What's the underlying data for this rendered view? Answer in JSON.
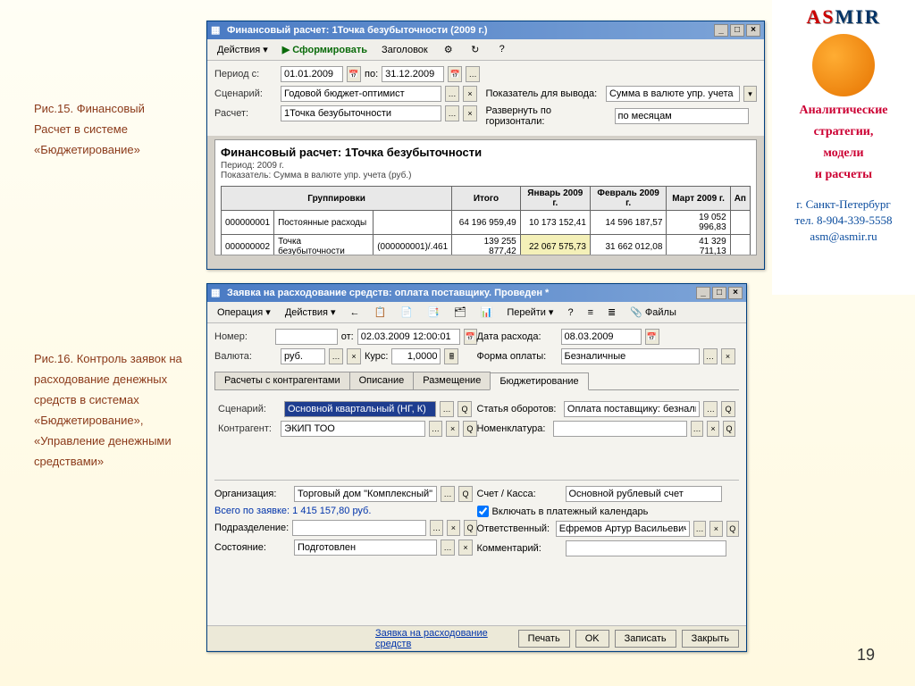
{
  "page_number": "19",
  "captions": {
    "fig15": "Рис.15. Финансовый Расчет в системе «Бюджетирование»",
    "fig16": "Рис.16. Контроль заявок на расходование денежных средств в системах «Бюджетирование», «Управление денежными средствами»"
  },
  "asmir": {
    "title1": "AS",
    "title2": "MIR",
    "sub1": "Аналитические",
    "sub2": "стратегии,",
    "sub3": "модели",
    "sub4": "и расчеты",
    "contact1": "г. Санкт-Петербург",
    "contact2": "тел. 8-904-339-5558",
    "contact3": "asm@asmir.ru"
  },
  "win1": {
    "title": "Финансовый расчет: 1Точка безубыточности (2009 г.)",
    "toolbar": {
      "actions": "Действия",
      "sform": "Сформировать",
      "header": "Заголовок"
    },
    "period_label": "Период с:",
    "period_from": "01.01.2009",
    "period_to_label": "по:",
    "period_to": "31.12.2009",
    "scenario_label": "Сценарий:",
    "scenario": "Годовой бюджет-оптимист",
    "rascht_label": "Расчет:",
    "rascht": "1Точка безубыточности",
    "indicator_label": "Показатель для вывода:",
    "indicator": "Сумма в валюте упр. учета",
    "expand_label": "Развернуть по горизонтали:",
    "expand": "по месяцам",
    "report": {
      "title": "Финансовый расчет: 1Точка безубыточности",
      "meta1": "Период: 2009 г.",
      "meta2": "Показатель: Сумма в валюте упр. учета (руб.)",
      "h_group": "Группировки",
      "h_total": "Итого",
      "h_jan": "Январь 2009 г.",
      "h_feb": "Февраль 2009 г.",
      "h_mar": "Март 2009 г.",
      "h_ap": "Ап",
      "rows": [
        {
          "code": "000000001",
          "name": "Постоянные расходы",
          "ext": "",
          "total": "64 196 959,49",
          "jan": "10 173 152,41",
          "feb": "14 596 187,57",
          "mar": "19 052 996,83"
        },
        {
          "code": "000000002",
          "name": "Точка безубыточности",
          "ext": "(000000001)/.461",
          "total": "139 255 877,42",
          "jan": "22 067 575,73",
          "feb": "31 662 012,08",
          "mar": "41 329 711,13"
        }
      ]
    }
  },
  "win2": {
    "title": "Заявка на расходование средств: оплата поставщику. Проведен *",
    "toolbar": {
      "operation": "Операция",
      "actions": "Действия",
      "goto": "Перейти",
      "files": "Файлы"
    },
    "number_label": "Номер:",
    "number": "",
    "ot_label": "от:",
    "ot": "02.03.2009 12:00:01",
    "date_label": "Дата расхода:",
    "date": "08.03.2009",
    "currency_label": "Валюта:",
    "currency": "руб.",
    "rate_label": "Курс:",
    "rate": "1,0000",
    "payform_label": "Форма оплаты:",
    "payform": "Безналичные",
    "tabs": {
      "t1": "Расчеты с контрагентами",
      "t2": "Описание",
      "t3": "Размещение",
      "t4": "Бюджетирование"
    },
    "scenario_label": "Сценарий:",
    "scenario": "Основной квартальный (НГ, К)",
    "article_label": "Статья оборотов:",
    "article": "Оплата поставщику: безналичный р...",
    "contragent_label": "Контрагент:",
    "contragent": "ЭКИП ТОО",
    "nomen_label": "Номенклатура:",
    "nomen": "",
    "org_label": "Организация:",
    "org": "Торговый дом \"Комплексный\"",
    "account_label": "Счет / Касса:",
    "account": "Основной рублевый счет",
    "total_label": "Всего по заявке: 1 415 157,80 руб.",
    "calendar_chk": "Включать в платежный календарь",
    "dept_label": "Подразделение:",
    "dept": "",
    "resp_label": "Ответственный:",
    "resp": "Ефремов Артур Васильевич",
    "status_label": "Состояние:",
    "status": "Подготовлен",
    "comment_label": "Комментарий:",
    "comment": "",
    "footer": {
      "text": "Заявка на расходование средств",
      "print": "Печать",
      "ok": "OK",
      "save": "Записать",
      "close": "Закрыть"
    }
  }
}
